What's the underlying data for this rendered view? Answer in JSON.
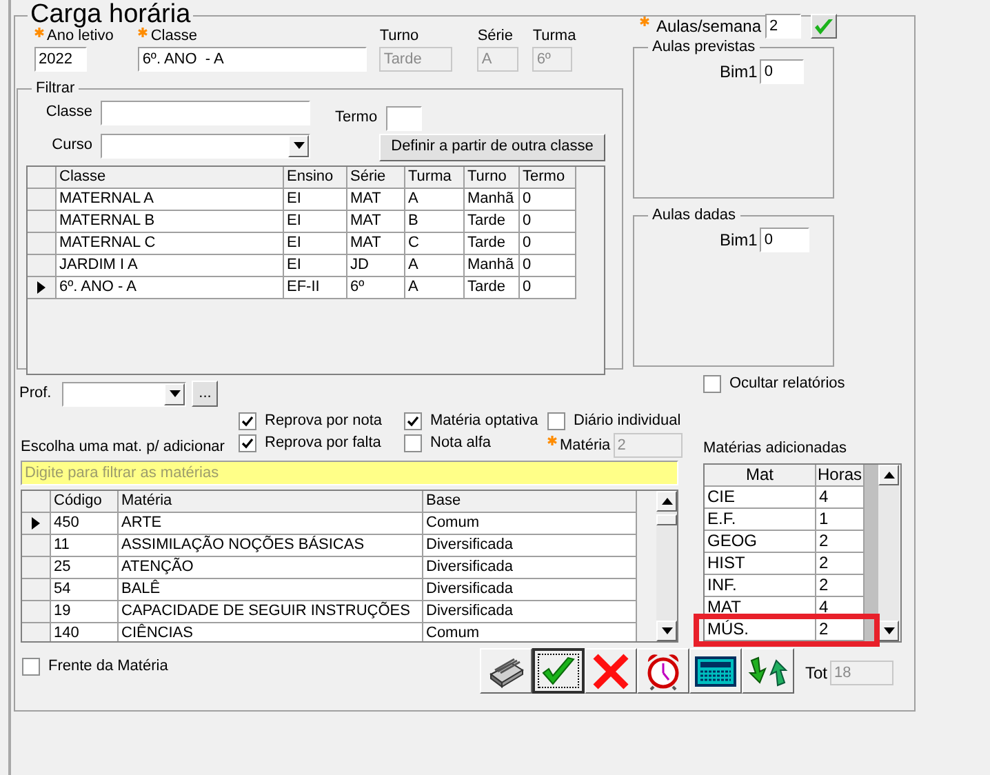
{
  "title": "Carga horária",
  "header_fields": [
    {
      "label": "Ano letivo",
      "value": "2022",
      "required": true,
      "disabled": false
    },
    {
      "label": "Classe",
      "value": "6º. ANO  - A",
      "required": true,
      "disabled": false
    },
    {
      "label": "Turno",
      "value": "Tarde",
      "required": false,
      "disabled": true
    },
    {
      "label": "Série",
      "value": "A",
      "required": false,
      "disabled": true
    },
    {
      "label": "Turma",
      "value": "6º",
      "required": false,
      "disabled": true
    }
  ],
  "aulas_semana": {
    "label": "Aulas/semana",
    "value": "2",
    "required": true
  },
  "filtrar": {
    "title": "Filtrar",
    "classe_label": "Classe",
    "termo_label": "Termo",
    "curso_label": "Curso",
    "button": "Definir a partir de outra classe",
    "columns": [
      "Classe",
      "Ensino",
      "Série",
      "Turma",
      "Turno",
      "Termo"
    ],
    "rows": [
      {
        "cells": [
          "MATERNAL A",
          "EI",
          "MAT",
          "A",
          "Manhã",
          "0"
        ],
        "current": false
      },
      {
        "cells": [
          "MATERNAL B",
          "EI",
          "MAT",
          "B",
          "Tarde",
          "0"
        ],
        "current": false
      },
      {
        "cells": [
          "MATERNAL C",
          "EI",
          "MAT",
          "C",
          "Tarde",
          "0"
        ],
        "current": false
      },
      {
        "cells": [
          "JARDIM I A",
          "EI",
          "JD",
          "A",
          "Manhã",
          "0"
        ],
        "current": false
      },
      {
        "cells": [
          "6º. ANO  - A",
          "EF-II",
          "6º",
          "A",
          "Tarde",
          "0"
        ],
        "current": true
      }
    ]
  },
  "aulas_previstas": {
    "title": "Aulas previstas",
    "label": "Bim1",
    "value": "0"
  },
  "aulas_dadas": {
    "title": "Aulas dadas",
    "label": "Bim1",
    "value": "0"
  },
  "ocultar_relatorios": {
    "label": "Ocultar relatórios",
    "checked": false
  },
  "prof": {
    "label": "Prof.",
    "button": "..."
  },
  "escolha_label": "Escolha uma mat. p/ adicionar",
  "options": [
    {
      "label": "Reprova por nota",
      "checked": true
    },
    {
      "label": "Reprova por falta",
      "checked": true
    },
    {
      "label": "Matéria optativa",
      "checked": true
    },
    {
      "label": "Nota alfa",
      "checked": false
    },
    {
      "label": "Diário individual",
      "checked": false
    }
  ],
  "materia_field": {
    "label": "Matéria",
    "value": "2",
    "required": true,
    "disabled": true
  },
  "filter": {
    "placeholder": "Digite para filtrar as matérias"
  },
  "materias": {
    "columns": [
      "Código",
      "Matéria",
      "Base"
    ],
    "rows": [
      {
        "cells": [
          "450",
          "ARTE",
          "Comum"
        ],
        "current": true
      },
      {
        "cells": [
          "11",
          "ASSIMILAÇÃO NOÇÕES BÁSICAS",
          "Diversificada"
        ],
        "current": false
      },
      {
        "cells": [
          "25",
          "ATENÇÃO",
          "Diversificada"
        ],
        "current": false
      },
      {
        "cells": [
          "54",
          "BALÊ",
          "Diversificada"
        ],
        "current": false
      },
      {
        "cells": [
          "19",
          "CAPACIDADE DE SEGUIR INSTRUÇÕES",
          "Diversificada"
        ],
        "current": false
      },
      {
        "cells": [
          "140",
          "CIÊNCIAS",
          "Comum"
        ],
        "current": false
      }
    ]
  },
  "adicionadas": {
    "title": "Matérias adicionadas",
    "columns": [
      "Mat",
      "Horas"
    ],
    "rows": [
      {
        "cells": [
          "CIE",
          "4"
        ],
        "highlighted": false
      },
      {
        "cells": [
          "E.F.",
          "1"
        ],
        "highlighted": false
      },
      {
        "cells": [
          "GEOG",
          "2"
        ],
        "highlighted": false
      },
      {
        "cells": [
          "HIST",
          "2"
        ],
        "highlighted": false
      },
      {
        "cells": [
          "INF.",
          "2"
        ],
        "highlighted": false
      },
      {
        "cells": [
          "MAT",
          "4"
        ],
        "highlighted": false
      },
      {
        "cells": [
          "MÚS.",
          "2"
        ],
        "highlighted": true
      }
    ]
  },
  "frente_materia": {
    "label": "Frente da Matéria",
    "checked": false
  },
  "toolbar": [
    {
      "kind": "cards",
      "focused": false
    },
    {
      "kind": "confirm",
      "focused": true
    },
    {
      "kind": "cancel",
      "focused": false
    },
    {
      "kind": "clock",
      "focused": false
    },
    {
      "kind": "calculator",
      "focused": false
    },
    {
      "kind": "swap",
      "focused": false
    }
  ],
  "total": {
    "label": "Tot",
    "value": "18"
  }
}
